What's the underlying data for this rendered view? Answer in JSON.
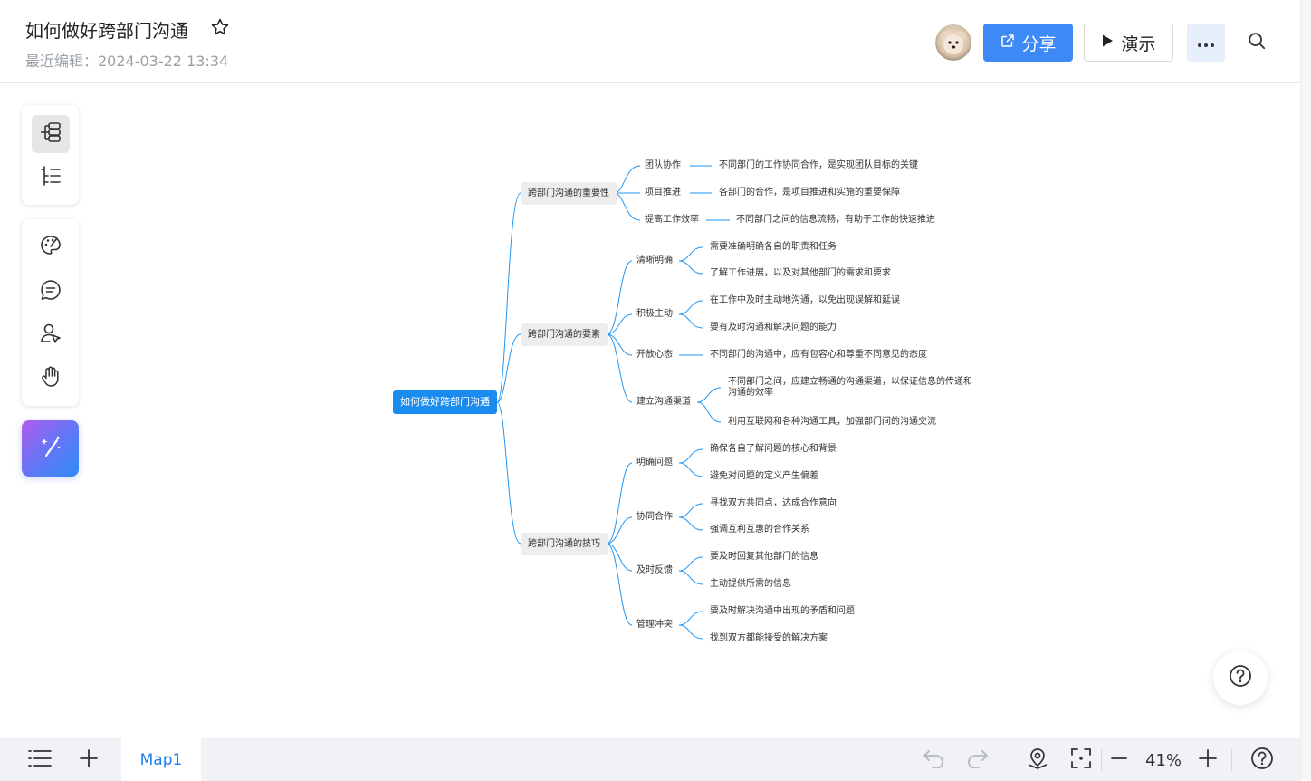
{
  "header": {
    "title": "如何做好跨部门沟通",
    "last_edit": "最近编辑：2024-03-22 13:34",
    "share_label": "分享",
    "present_label": "演示"
  },
  "icons": {
    "star": "star-icon",
    "share": "external-link-icon",
    "present": "play-icon",
    "more": "more-icon",
    "search": "search-icon",
    "help": "help-icon"
  },
  "colors": {
    "accent": "#3d8af7",
    "root_node": "#1a8cf0",
    "connector": "#2196f3",
    "branch_node": "#ededed"
  },
  "mindmap": {
    "root": "如何做好跨部门沟通",
    "branches": [
      {
        "label": "跨部门沟通的重要性",
        "children": [
          {
            "label": "团队协作",
            "children": [
              "不同部门的工作协同合作，是实现团队目标的关键"
            ]
          },
          {
            "label": "项目推进",
            "children": [
              "各部门的合作，是项目推进和实施的重要保障"
            ]
          },
          {
            "label": "提高工作效率",
            "children": [
              "不同部门之间的信息流畅，有助于工作的快速推进"
            ]
          }
        ]
      },
      {
        "label": "跨部门沟通的要素",
        "children": [
          {
            "label": "清晰明确",
            "children": [
              "需要准确明确各自的职责和任务",
              "了解工作进展，以及对其他部门的需求和要求"
            ]
          },
          {
            "label": "积极主动",
            "children": [
              "在工作中及时主动地沟通，以免出现误解和延误",
              "要有及时沟通和解决问题的能力"
            ]
          },
          {
            "label": "开放心态",
            "children": [
              "不同部门的沟通中，应有包容心和尊重不同意见的态度"
            ]
          },
          {
            "label": "建立沟通渠道",
            "children": [
              "不同部门之间，应建立畅通的沟通渠道，以保证信息的传递和沟通的效率",
              "利用互联网和各种沟通工具，加强部门间的沟通交流"
            ]
          }
        ]
      },
      {
        "label": "跨部门沟通的技巧",
        "children": [
          {
            "label": "明确问题",
            "children": [
              "确保各自了解问题的核心和背景",
              "避免对问题的定义产生偏差"
            ]
          },
          {
            "label": "协同合作",
            "children": [
              "寻找双方共同点，达成合作意向",
              "强调互利互惠的合作关系"
            ]
          },
          {
            "label": "及时反馈",
            "children": [
              "要及时回复其他部门的信息",
              "主动提供所需的信息"
            ]
          },
          {
            "label": "管理冲突",
            "children": [
              "要及时解决沟通中出现的矛盾和问题",
              "找到双方都能接受的解决方案"
            ]
          }
        ]
      }
    ]
  },
  "bottombar": {
    "sheet_tab": "Map1",
    "zoom": "41%"
  }
}
